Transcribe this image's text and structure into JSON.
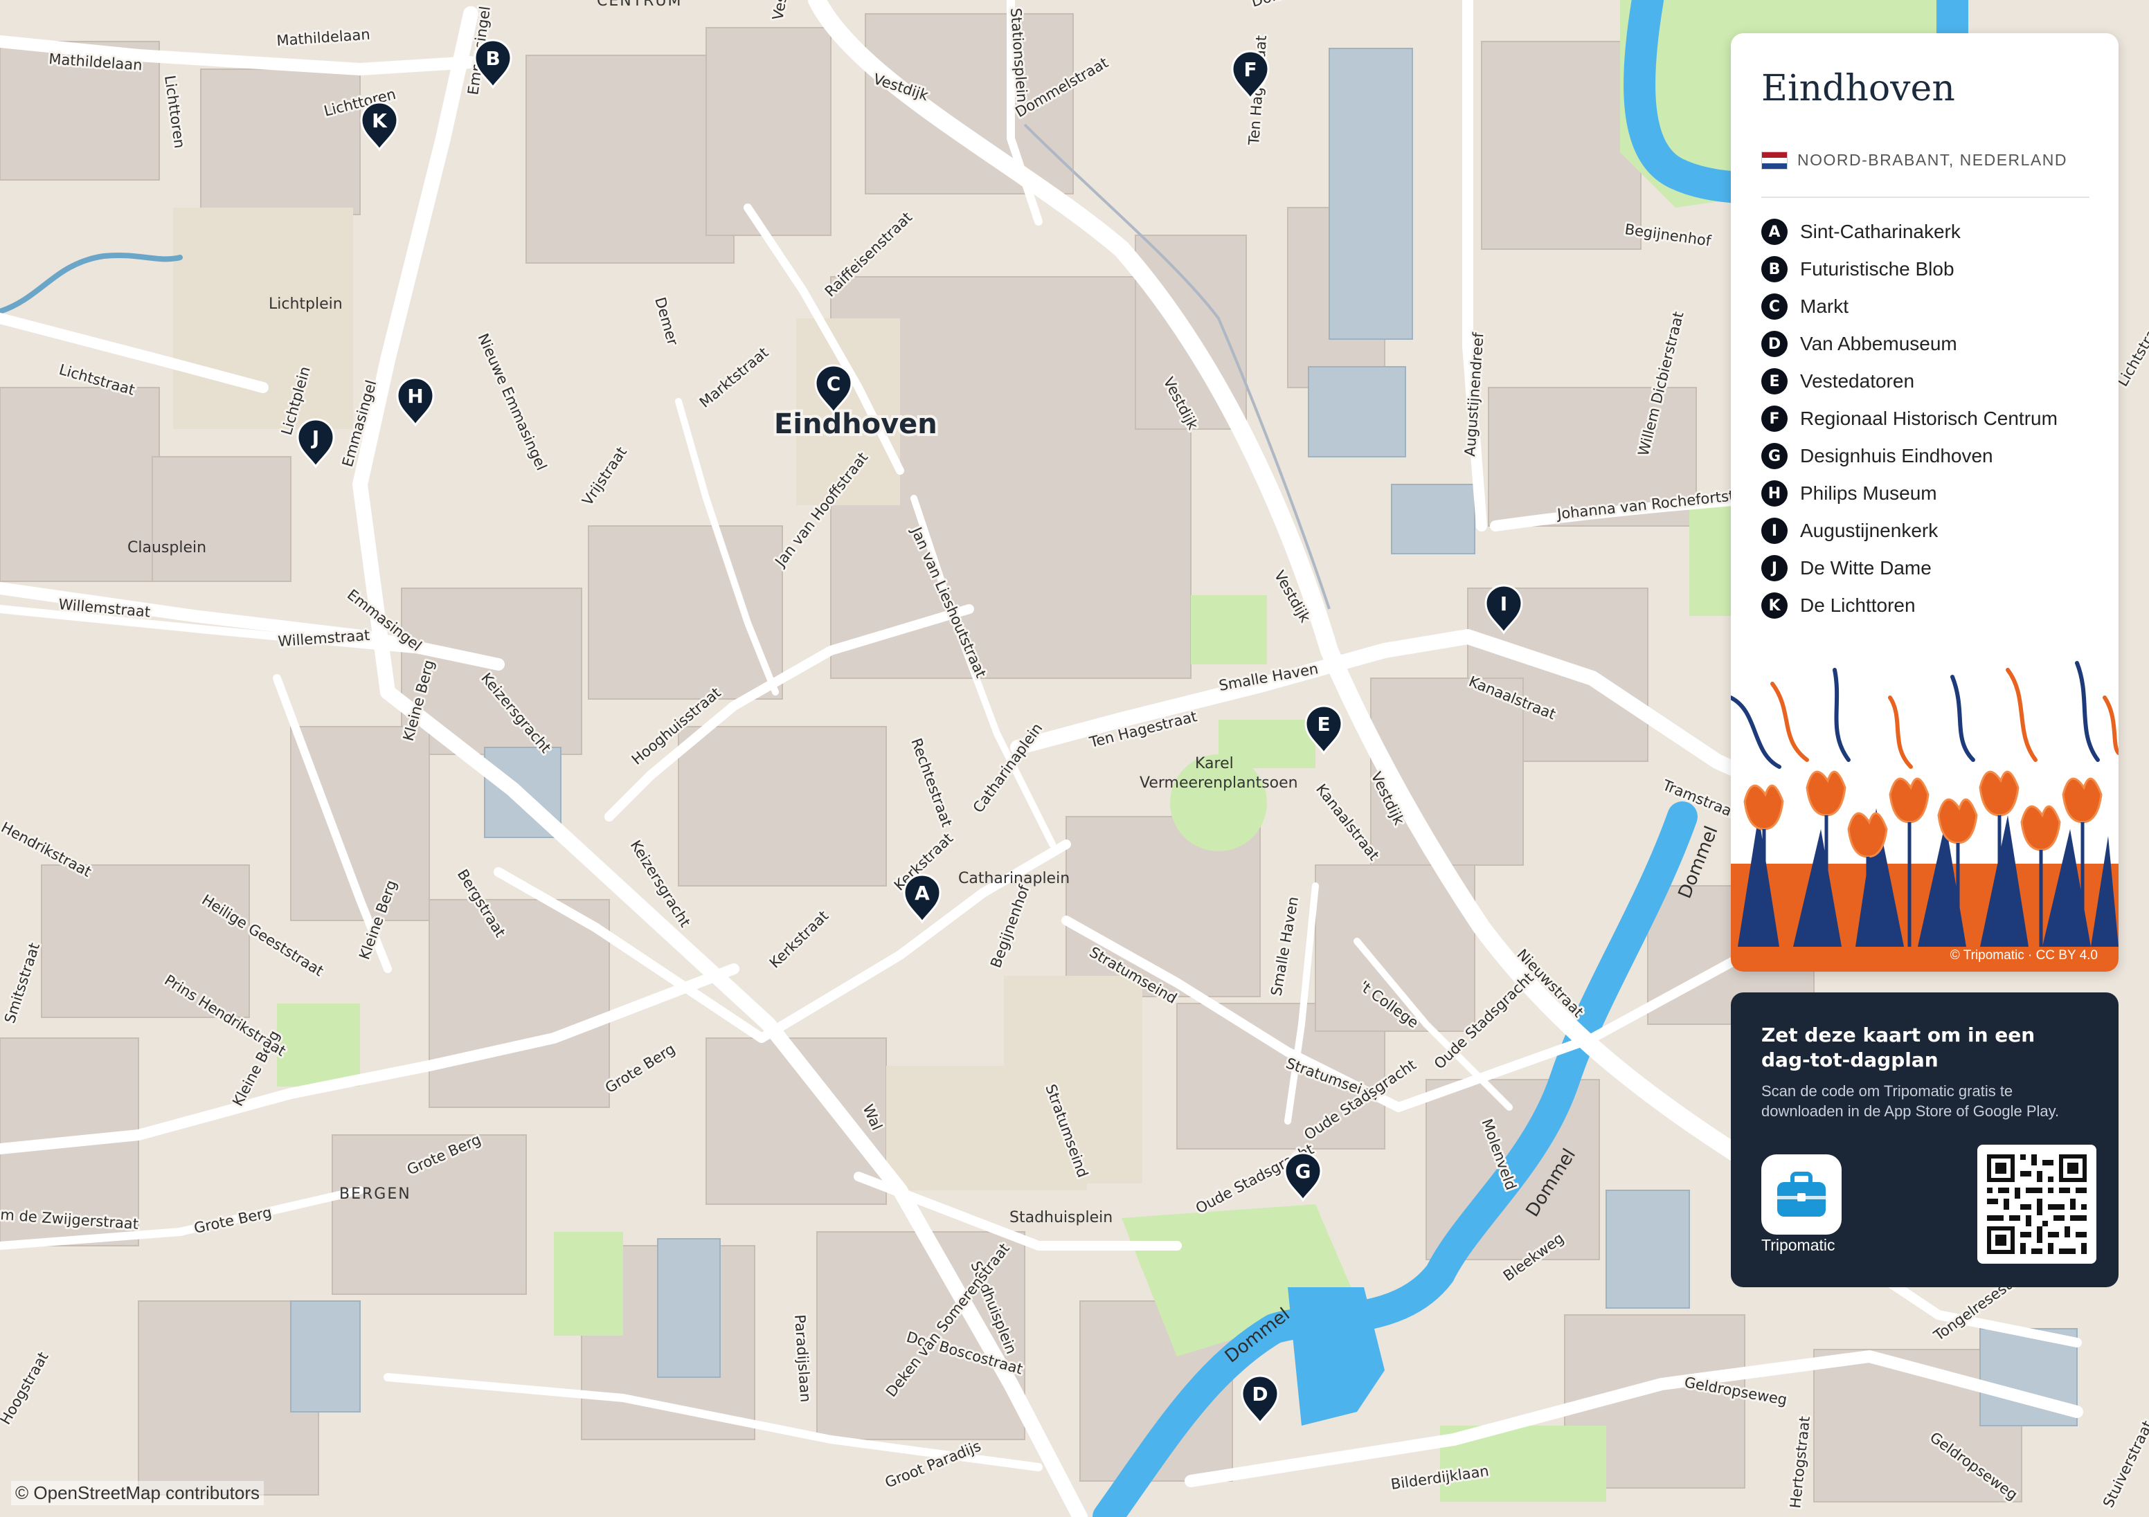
{
  "map": {
    "city_label": "Eindhoven",
    "district_labels": [
      "CENTRUM",
      "BERGEN"
    ],
    "place_labels": [
      "Lichtplein",
      "Clausplein",
      "Catharinaplein",
      "Stadhuisplein",
      "Karel",
      "Vermeerenplantsoen"
    ],
    "water_labels": [
      "Dommel",
      "Dommel",
      "Dommel"
    ],
    "street_labels": [
      "Mathildelaan",
      "Mathildelaan",
      "Lichttoren",
      "Lichttoren",
      "Emmasingel",
      "Lichtstraat",
      "Lichtplein",
      "Emmasingel",
      "Nieuwe Emmasingel",
      "Willemstraat",
      "Willemstraat",
      "Emmasingel",
      "Keizersgracht",
      "Keizersgracht",
      "Kleine Berg",
      "Kleine Berg",
      "Kleine Berg",
      "Bergstraat",
      "Heilige Geeststraat",
      "Prins Hendrikstraat",
      "Smitsstraat",
      "Hendrikstraat",
      "Grote Berg",
      "Grote Berg",
      "Grote Berg",
      "Demer",
      "Marktstraat",
      "Vrijstraat",
      "Jan van Hooffstraat",
      "Jan van Lieshoutstraat",
      "Hooghuisstraat",
      "Rechtestraat",
      "Catharinaplein",
      "Kerkstraat",
      "Kerkstraat",
      "Wal",
      "Stationsplein",
      "Dommelstraat",
      "Dommelstraat",
      "Vestdijk",
      "Vestdijk",
      "Vestdijk",
      "Vestdijk",
      "Vestdijk",
      "Nieuwstraat",
      "Raiffeisenstraat",
      "Ten Hagestraat",
      "Ten Hagestraat",
      "Smalle Haven",
      "Smalle Haven",
      "Kanaalstraat",
      "Kanaalstraat",
      "Tramstraat",
      "Augustijnendreef",
      "Johanna van Rochefortstraat",
      "Willem Dicbierstraat",
      "Begijnenhof",
      "Begijnenhof",
      "Stratumseind",
      "Stratumseind",
      "Stratumseind",
      "'t College",
      "Oude Stadsgracht",
      "Oude Stadsgracht",
      "Oude Stadsgracht",
      "Molenveld",
      "Bleekweg",
      "Stadhuisplein",
      "Paradijslaan",
      "Don Boscostraat",
      "Deken van Somerenstraat",
      "Hoogstraat",
      "Groot Paradijs",
      "Geldropseweg",
      "Geldropseweg",
      "Bilderdijklaan",
      "Hertogstraat",
      "Stuiverstraat",
      "Tongelresestraat",
      "Lichtstraat",
      "m de Zwijgerstraat"
    ],
    "markers": [
      {
        "letter": "A"
      },
      {
        "letter": "B"
      },
      {
        "letter": "C"
      },
      {
        "letter": "D"
      },
      {
        "letter": "E"
      },
      {
        "letter": "F"
      },
      {
        "letter": "G"
      },
      {
        "letter": "H"
      },
      {
        "letter": "I"
      },
      {
        "letter": "J"
      },
      {
        "letter": "K"
      }
    ],
    "attribution": "© OpenStreetMap contributors"
  },
  "panel": {
    "title": "Eindhoven",
    "subtitle": "NOORD-BRABANT, NEDERLAND",
    "flag": "nl-flag-icon",
    "pois": [
      {
        "letter": "A",
        "name": "Sint-Catharinakerk"
      },
      {
        "letter": "B",
        "name": "Futuristische Blob"
      },
      {
        "letter": "C",
        "name": "Markt"
      },
      {
        "letter": "D",
        "name": "Van Abbemuseum"
      },
      {
        "letter": "E",
        "name": "Vestedatoren"
      },
      {
        "letter": "F",
        "name": "Regionaal Historisch Centrum"
      },
      {
        "letter": "G",
        "name": "Designhuis Eindhoven"
      },
      {
        "letter": "H",
        "name": "Philips Museum"
      },
      {
        "letter": "I",
        "name": "Augustijnenkerk"
      },
      {
        "letter": "J",
        "name": "De Witte Dame"
      },
      {
        "letter": "K",
        "name": "De Lichttoren"
      }
    ],
    "art_credit": "© Tripomatic · CC BY 4.0"
  },
  "promo": {
    "heading": "Zet deze kaart om in een dag-tot-dagplan",
    "text": "Scan de code om Tripomatic gratis te downloaden in de App Store of Google Play.",
    "app_name": "Tripomatic"
  },
  "colors": {
    "background": "#ece5dc",
    "building": "#d9d0c9",
    "water": "#4db3ec",
    "park": "#cdebb0",
    "road": "#ffffff",
    "marker": "#0e1f33",
    "panel_dark": "#1b2636",
    "tulip_orange": "#e8631f",
    "tulip_blue": "#1d3a7a"
  }
}
